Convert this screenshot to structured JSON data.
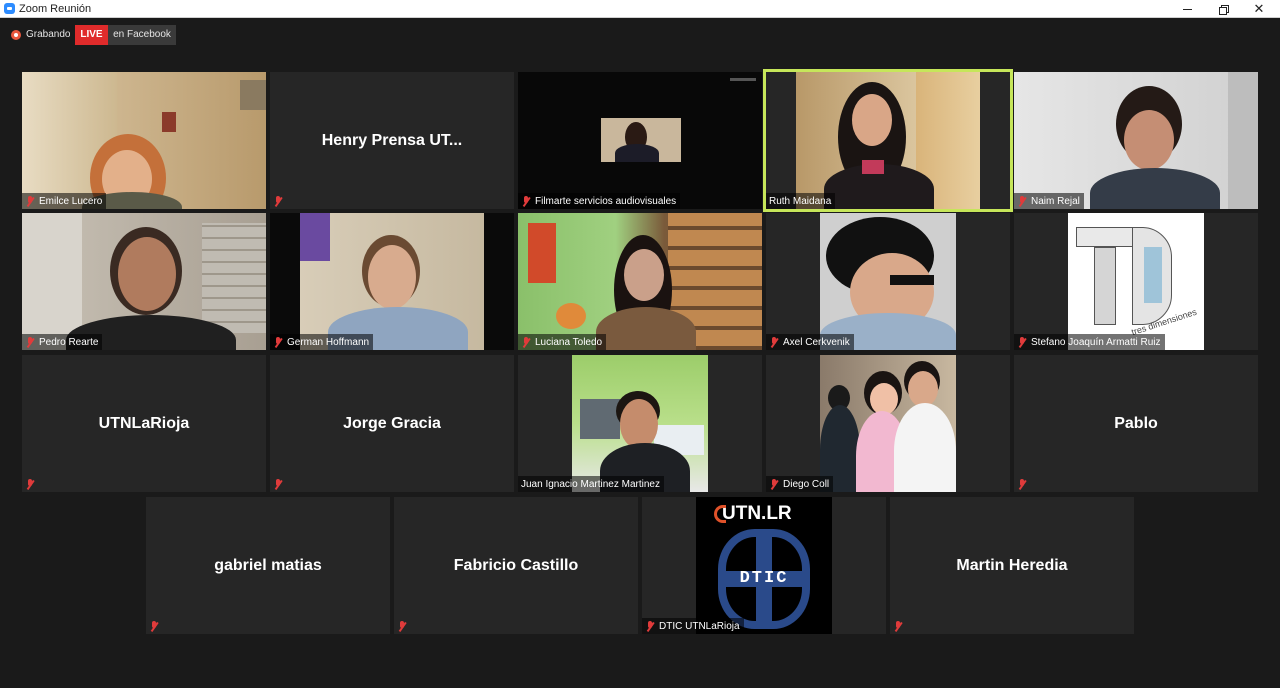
{
  "window": {
    "title": "Zoom Reunión",
    "minimize_label": "minimize",
    "maximize_label": "restore",
    "close_label": "✕"
  },
  "recording": {
    "status": "Grabando",
    "live_label": "LIVE",
    "destination": "en Facebook"
  },
  "participants": [
    {
      "name": "Emilce Lucero",
      "video": true
    },
    {
      "name": "Henry Prensa UT...",
      "video": false
    },
    {
      "name": "Filmarte servicios audiovisuales",
      "video": true
    },
    {
      "name": "Ruth Maidana",
      "video": true,
      "active_speaker": true
    },
    {
      "name": "Naim Rejal",
      "video": true
    },
    {
      "name": "Pedro Rearte",
      "video": true
    },
    {
      "name": "German Hoffmann",
      "video": true
    },
    {
      "name": "Luciana Toledo",
      "video": true
    },
    {
      "name": "Axel Cerkvenik",
      "video": true
    },
    {
      "name": "Stefano Joaquín Armatti Ruiz",
      "video": true
    },
    {
      "name": "UTNLaRioja",
      "video": false
    },
    {
      "name": "Jorge Gracia",
      "video": false
    },
    {
      "name": "Juan Ignacio Martinez Martinez",
      "video": true
    },
    {
      "name": "Diego Coll",
      "video": true
    },
    {
      "name": "Pablo",
      "video": false
    },
    {
      "name": "gabriel matias",
      "video": false
    },
    {
      "name": "Fabricio Castillo",
      "video": false
    },
    {
      "name": "DTIC UTNLaRioja",
      "video": true
    },
    {
      "name": "Martin Heredia",
      "video": false
    }
  ],
  "logos": {
    "td_caption": "tres dimensiones",
    "utn_text": "UTN.LR",
    "dtic_text": "DTIC"
  },
  "colors": {
    "background": "#1a1a1a",
    "tile": "#262626",
    "active_speaker_border": "#c6e65a",
    "live_red": "#e02b2b",
    "muted_icon": "#e03b3b"
  }
}
